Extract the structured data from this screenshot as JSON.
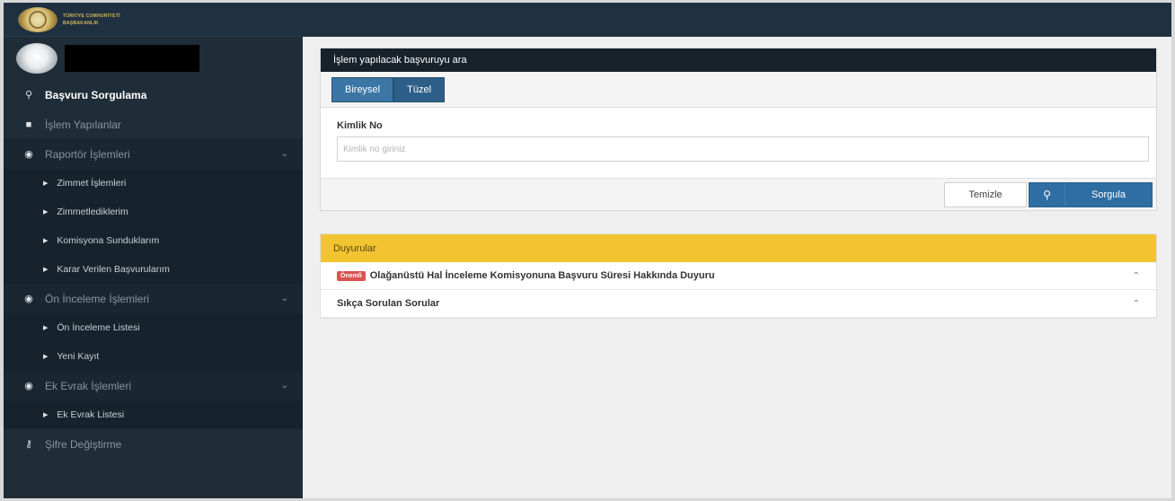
{
  "header": {
    "logo_line1": "TÜRKİYE CUMHURİYETİ",
    "logo_line2": "BAŞBAKANLIK"
  },
  "sidebar": {
    "items": [
      {
        "label": "Başvuru Sorgulama",
        "icon": "search-icon"
      },
      {
        "label": "İşlem Yapılanlar",
        "icon": "file-icon"
      },
      {
        "label": "Raportör İşlemleri",
        "icon": "group-icon"
      },
      {
        "label": "Ön İnceleme İşlemleri",
        "icon": "group-icon"
      },
      {
        "label": "Ek Evrak İşlemleri",
        "icon": "group-icon"
      },
      {
        "label": "Şifre Değiştirme",
        "icon": "key-icon"
      }
    ],
    "raportor_sub": [
      "Zimmet İşlemleri",
      "Zimmetlediklerim",
      "Komisyona Sunduklarım",
      "Karar Verilen Başvurularım"
    ],
    "on_inceleme_sub": [
      "Ön İnceleme Listesi",
      "Yeni Kayıt"
    ],
    "ek_evrak_sub": [
      "Ek Evrak Listesi"
    ]
  },
  "search_panel": {
    "title": "İşlem yapılacak başvuruyu ara",
    "tabs": [
      "Bireysel",
      "Tüzel"
    ],
    "field_label": "Kimlik No",
    "field_placeholder": "Kimlik no giriniz",
    "clear_label": "Temizle",
    "search_label": "Sorgula"
  },
  "announcements": {
    "title": "Duyurular",
    "items": [
      {
        "badge": "Önemli",
        "text": "Olağanüstü Hal İnceleme Komisyonuna Başvuru Süresi Hakkında Duyuru"
      },
      {
        "text": "Sıkça Sorulan Sorular"
      }
    ]
  },
  "colors": {
    "sidebar_bg": "#1e2d38",
    "panel_head": "#17222b",
    "primary_button": "#2f6ea3",
    "announcement_bar": "#f2c431",
    "badge": "#d9534f"
  }
}
